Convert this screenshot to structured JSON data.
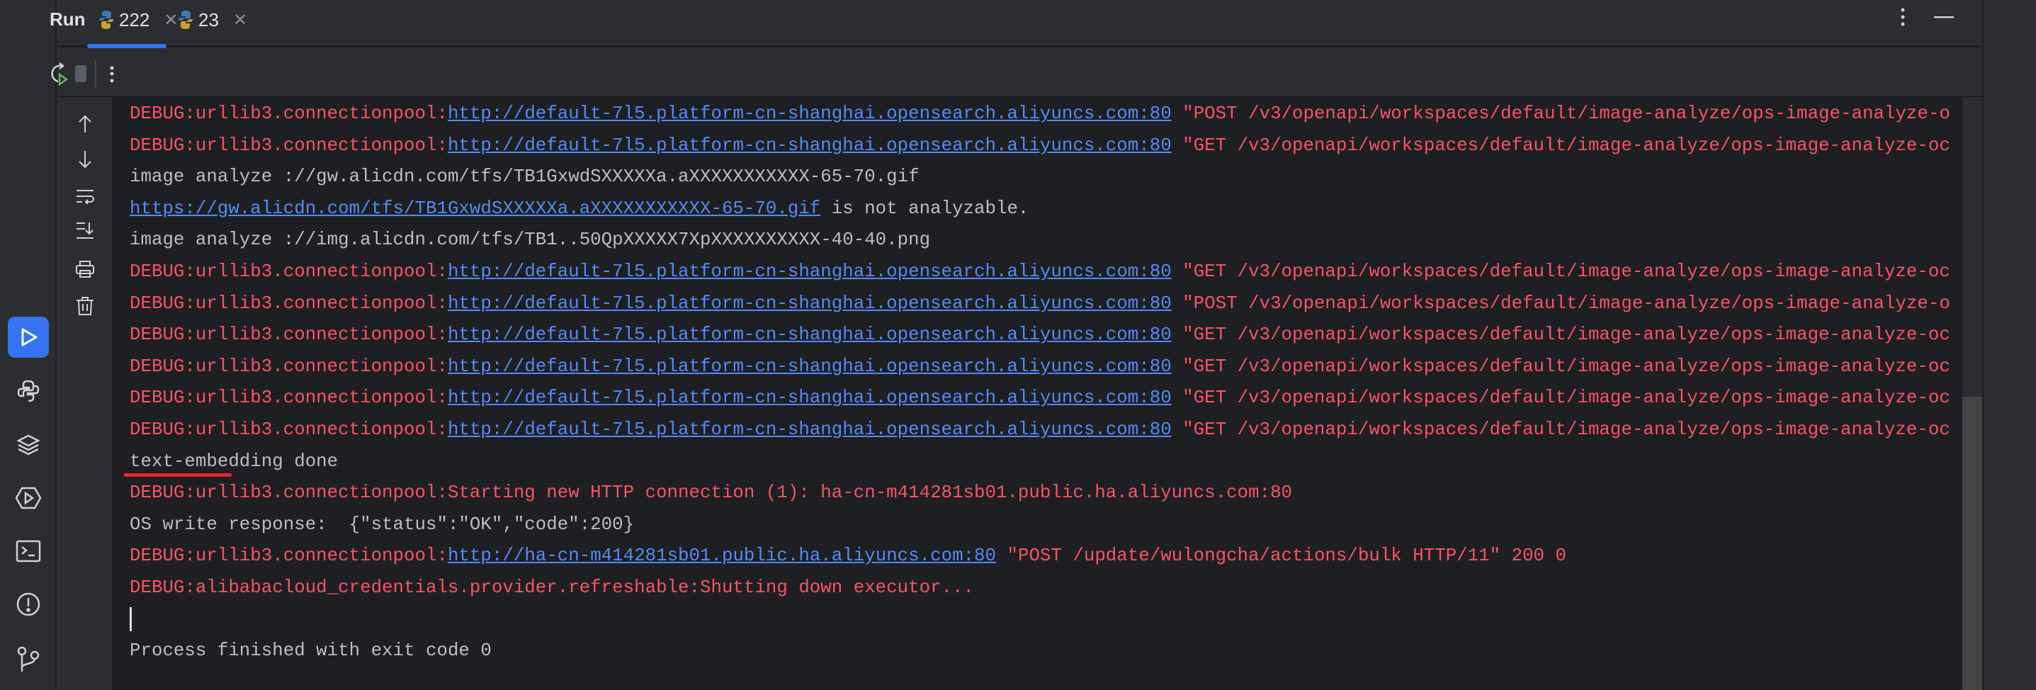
{
  "header": {
    "title": "Run",
    "tabs": [
      {
        "label": "222",
        "active": true
      },
      {
        "label": "23",
        "active": false
      }
    ]
  },
  "colors": {
    "accent": "#3574f0",
    "debug": "#f75464",
    "link": "#548af7",
    "text": "#bcbec4",
    "highlight": "#e8262b"
  },
  "activity_bar": [
    "run-icon",
    "python-icon",
    "layers-icon",
    "services-icon",
    "terminal-icon",
    "problems-icon",
    "git-icon"
  ],
  "console": {
    "lines": [
      [
        {
          "t": "red",
          "v": "DEBUG:urllib3.connectionpool:"
        },
        {
          "t": "link",
          "v": "http://default-7l5.platform-cn-shanghai.opensearch.aliyuncs.com:80"
        },
        {
          "t": "red",
          "v": " \"POST /v3/openapi/workspaces/default/image-analyze/ops-image-analyze-o"
        }
      ],
      [
        {
          "t": "red",
          "v": "DEBUG:urllib3.connectionpool:"
        },
        {
          "t": "link",
          "v": "http://default-7l5.platform-cn-shanghai.opensearch.aliyuncs.com:80"
        },
        {
          "t": "red",
          "v": " \"GET /v3/openapi/workspaces/default/image-analyze/ops-image-analyze-oc"
        }
      ],
      [
        {
          "t": "plain",
          "v": "image analyze ://gw.alicdn.com/tfs/TB1GxwdSXXXXXa.aXXXXXXXXXXX-65-70.gif"
        }
      ],
      [
        {
          "t": "link",
          "v": "https://gw.alicdn.com/tfs/TB1GxwdSXXXXXa.aXXXXXXXXXXX-65-70.gif"
        },
        {
          "t": "plain",
          "v": " is not analyzable."
        }
      ],
      [
        {
          "t": "plain",
          "v": "image analyze ://img.alicdn.com/tfs/TB1..50QpXXXXX7XpXXXXXXXXXX-40-40.png"
        }
      ],
      [
        {
          "t": "red",
          "v": "DEBUG:urllib3.connectionpool:"
        },
        {
          "t": "link",
          "v": "http://default-7l5.platform-cn-shanghai.opensearch.aliyuncs.com:80"
        },
        {
          "t": "red",
          "v": " \"GET /v3/openapi/workspaces/default/image-analyze/ops-image-analyze-oc"
        }
      ],
      [
        {
          "t": "red",
          "v": "DEBUG:urllib3.connectionpool:"
        },
        {
          "t": "link",
          "v": "http://default-7l5.platform-cn-shanghai.opensearch.aliyuncs.com:80"
        },
        {
          "t": "red",
          "v": " \"POST /v3/openapi/workspaces/default/image-analyze/ops-image-analyze-o"
        }
      ],
      [
        {
          "t": "red",
          "v": "DEBUG:urllib3.connectionpool:"
        },
        {
          "t": "link",
          "v": "http://default-7l5.platform-cn-shanghai.opensearch.aliyuncs.com:80"
        },
        {
          "t": "red",
          "v": " \"GET /v3/openapi/workspaces/default/image-analyze/ops-image-analyze-oc"
        }
      ],
      [
        {
          "t": "red",
          "v": "DEBUG:urllib3.connectionpool:"
        },
        {
          "t": "link",
          "v": "http://default-7l5.platform-cn-shanghai.opensearch.aliyuncs.com:80"
        },
        {
          "t": "red",
          "v": " \"GET /v3/openapi/workspaces/default/image-analyze/ops-image-analyze-oc"
        }
      ],
      [
        {
          "t": "red",
          "v": "DEBUG:urllib3.connectionpool:"
        },
        {
          "t": "link",
          "v": "http://default-7l5.platform-cn-shanghai.opensearch.aliyuncs.com:80"
        },
        {
          "t": "red",
          "v": " \"GET /v3/openapi/workspaces/default/image-analyze/ops-image-analyze-oc"
        }
      ],
      [
        {
          "t": "red",
          "v": "DEBUG:urllib3.connectionpool:"
        },
        {
          "t": "link",
          "v": "http://default-7l5.platform-cn-shanghai.opensearch.aliyuncs.com:80"
        },
        {
          "t": "red",
          "v": " \"GET /v3/openapi/workspaces/default/image-analyze/ops-image-analyze-oc"
        }
      ],
      [
        {
          "t": "plain",
          "v": "text-embedding done",
          "mark": true
        }
      ],
      [
        {
          "t": "red",
          "v": "DEBUG:urllib3.connectionpool:Starting new HTTP connection (1): ha-cn-m414281sb01.public.ha.aliyuncs.com:80"
        }
      ],
      [
        {
          "t": "plain",
          "v": "OS write response:  {\"status\":\"OK\",\"code\":200}"
        }
      ],
      [
        {
          "t": "red",
          "v": "DEBUG:urllib3.connectionpool:"
        },
        {
          "t": "link",
          "v": "http://ha-cn-m414281sb01.public.ha.aliyuncs.com:80"
        },
        {
          "t": "red",
          "v": " \"POST /update/wulongcha/actions/bulk HTTP/11\" 200 0"
        }
      ],
      [
        {
          "t": "red",
          "v": "DEBUG:alibabacloud_credentials.provider.refreshable:Shutting down executor..."
        }
      ],
      [
        {
          "t": "cursor",
          "v": ""
        }
      ],
      [
        {
          "t": "plain",
          "v": "Process finished with exit code 0"
        }
      ]
    ]
  }
}
